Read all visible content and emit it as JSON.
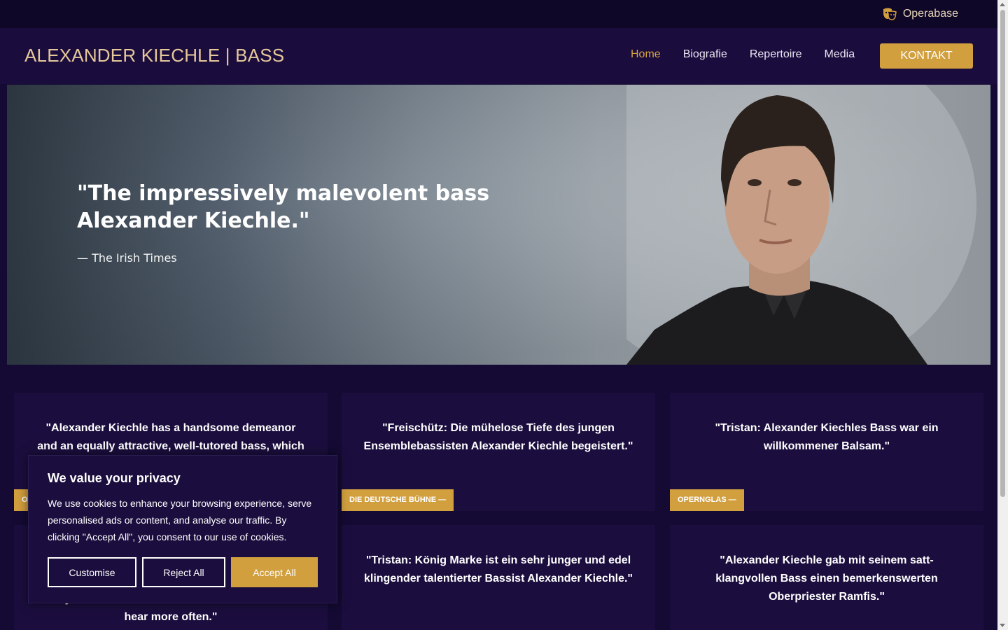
{
  "topbar": {
    "operabase_label": "Operabase",
    "icon": "theater-mask-icon"
  },
  "nav": {
    "brand": "ALEXANDER KIECHLE | BASS",
    "items": [
      {
        "label": "Home",
        "active": true
      },
      {
        "label": "Biografie"
      },
      {
        "label": "Repertoire"
      },
      {
        "label": "Media"
      }
    ],
    "cta": "KONTAKT"
  },
  "hero": {
    "quote": "\"The impressively malevolent bass Alexander Kiechle.\"",
    "source": "— The Irish Times"
  },
  "reviews": [
    {
      "text": "\"Alexander Kiechle has a handsome demeanor and an equally attractive, well-tutored bass, which",
      "tag": "OI"
    },
    {
      "text": "\"Freischütz: Die mühelose Tiefe des jungen Ensemblebassisten Alexander Kiechle begeistert.\"",
      "tag": "DIE DEUTSCHE BÜHNE —"
    },
    {
      "text": "\"Tristan: Alexander Kiechles Bass war ein willkommener Balsam.\"",
      "tag": "OPERNGLAS —"
    },
    {
      "text": "easy resonance and sheen — a voice I'd like to hear more often.\""
    },
    {
      "text": "\"Tristan: König Marke ist ein sehr junger und edel klingender talentierter Bassist Alexander Kiechle.\""
    },
    {
      "text": "\"Alexander Kiechle gab mit seinem satt-klangvollen Bass einen bemerkenswerten Oberpriester Ramfis.\""
    }
  ],
  "cookie": {
    "title": "We value your privacy",
    "text": "We use cookies to enhance your browsing experience, serve personalised ads or content, and analyse our traffic. By clicking \"Accept All\", you consent to our use of cookies.",
    "customise": "Customise",
    "reject": "Reject All",
    "accept": "Accept All"
  },
  "colors": {
    "accent": "#d19f3e",
    "bg": "#140a33",
    "nav": "#1a0d3d",
    "card": "#1b0e3e"
  }
}
